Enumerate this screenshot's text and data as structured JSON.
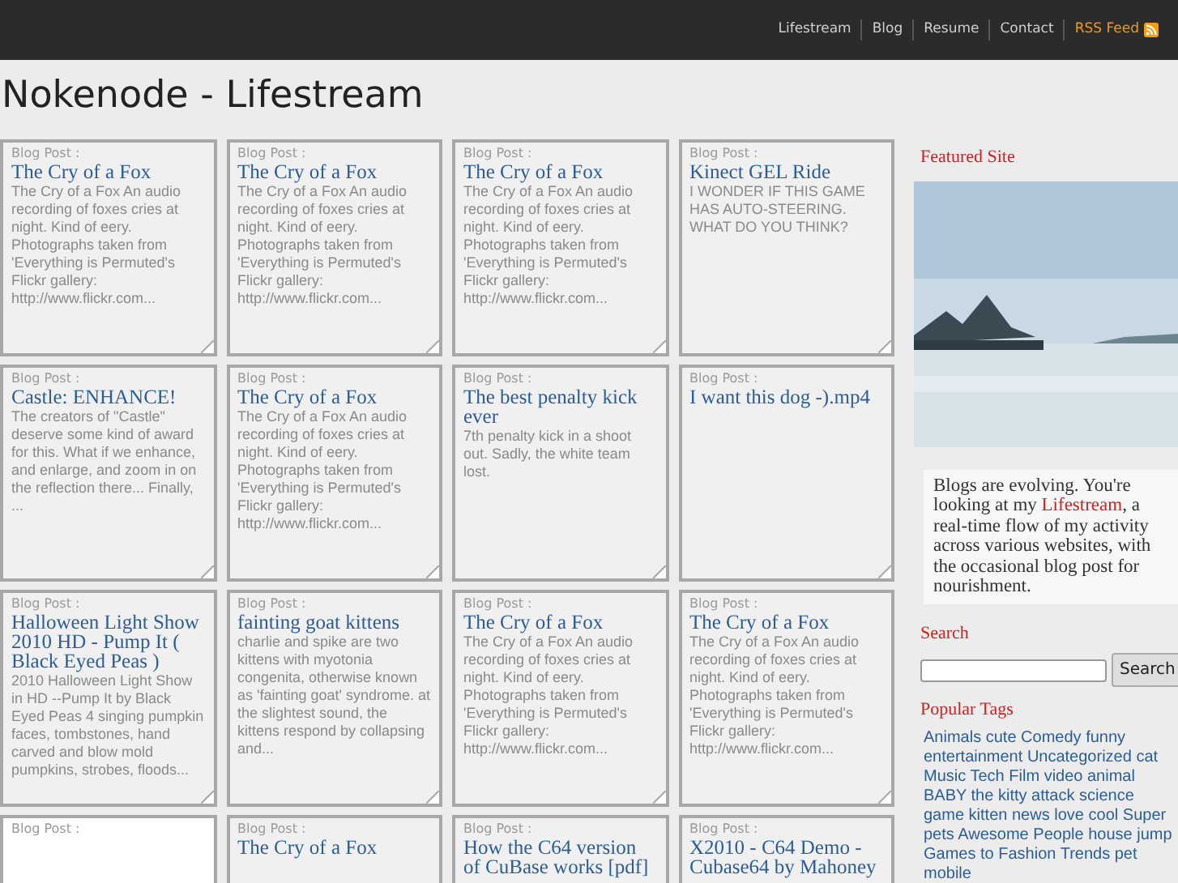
{
  "nav": [
    {
      "label": "Lifestream",
      "kind": "link"
    },
    {
      "label": "Blog",
      "kind": "link"
    },
    {
      "label": "Resume",
      "kind": "link"
    },
    {
      "label": "Contact",
      "kind": "link"
    },
    {
      "label": "RSS Feed",
      "kind": "feed"
    }
  ],
  "page_title": "Nokenode - Lifestream",
  "posts": [
    {
      "kind": "text",
      "folded": true,
      "category": "Blog Post :",
      "title": "The Cry of a Fox",
      "body": "The Cry of a Fox An audio recording of foxes cries at night. Kind of eery. Photographs taken from 'Everything is Permuted's Flickr gallery: http://www.flickr.com..."
    },
    {
      "kind": "text",
      "folded": true,
      "category": "Blog Post :",
      "title": "The Cry of a Fox",
      "body": "The Cry of a Fox An audio recording of foxes cries at night. Kind of eery. Photographs taken from 'Everything is Permuted's Flickr gallery: http://www.flickr.com..."
    },
    {
      "kind": "text",
      "folded": true,
      "category": "Blog Post :",
      "title": "The Cry of a Fox",
      "body": "The Cry of a Fox An audio recording of foxes cries at night. Kind of eery. Photographs taken from 'Everything is Permuted's Flickr gallery: http://www.flickr.com..."
    },
    {
      "kind": "text",
      "folded": true,
      "category": "Blog Post :",
      "title": "Kinect GEL Ride",
      "body": "I WONDER IF THIS GAME HAS AUTO-STEERING. WHAT DO YOU THINK?"
    },
    {
      "kind": "text",
      "folded": true,
      "category": "Blog Post :",
      "title": "Castle: ENHANCE!",
      "body": "The creators of \"Castle\" deserve some kind of award for this. What if we enhance, and enlarge, and zoom in on the reflection there... Finally, ..."
    },
    {
      "kind": "text",
      "folded": true,
      "category": "Blog Post :",
      "title": "The Cry of a Fox",
      "body": "The Cry of a Fox An audio recording of foxes cries at night. Kind of eery. Photographs taken from 'Everything is Permuted's Flickr gallery: http://www.flickr.com..."
    },
    {
      "kind": "text",
      "folded": true,
      "category": "Blog Post :",
      "title": "The best penalty kick ever",
      "body": "7th penalty kick in a shoot out. Sadly, the white team lost."
    },
    {
      "kind": "text",
      "folded": true,
      "category": "Blog Post :",
      "title": "I want this dog -).mp4"
    },
    {
      "kind": "text",
      "folded": true,
      "category": "Blog Post :",
      "title": "Halloween Light Show 2010 HD - Pump It ( Black Eyed Peas )",
      "body": "2010 Halloween Light Show in HD --Pump It by Black Eyed Peas 4 singing pumpkin faces, tombstones, hand carved and blow mold pumpkins, strobes, floods..."
    },
    {
      "kind": "text",
      "folded": true,
      "category": "Blog Post :",
      "title": "fainting goat kittens",
      "body": "charlie and spike are two kittens with myotonia congenita, otherwise known as 'fainting goat' syndrome. at the slightest sound, the kittens respond by collapsing and..."
    },
    {
      "kind": "text",
      "folded": true,
      "category": "Blog Post :",
      "title": "The Cry of a Fox",
      "body": "The Cry of a Fox An audio recording of foxes cries at night. Kind of eery. Photographs taken from 'Everything is Permuted's Flickr gallery: http://www.flickr.com..."
    },
    {
      "kind": "text",
      "folded": true,
      "category": "Blog Post :",
      "title": "The Cry of a Fox",
      "body": "The Cry of a Fox An audio recording of foxes cries at night. Kind of eery. Photographs taken from 'Everything is Permuted's Flickr gallery: http://www.flickr.com..."
    },
    {
      "kind": "picture",
      "category": "Blog Post :"
    },
    {
      "kind": "text",
      "category": "Blog Post :",
      "title": "The Cry of a Fox"
    },
    {
      "kind": "text",
      "category": "Blog Post :",
      "title": "How the C64 version of CuBase works [pdf]"
    },
    {
      "kind": "text",
      "category": "Blog Post :",
      "title": "X2010 - C64 Demo - Cubase64 by Mahoney"
    }
  ],
  "sidebar": {
    "featured_heading": "Featured Site",
    "about": "Blogs are evolving. You're looking at my ",
    "about_link": "Lifestream",
    "about_rest": ", a real-time flow of my activity across various websites, with the occasional blog post for nourishment.",
    "search_heading": "Search",
    "search_button": "Search",
    "tags_heading": "Popular Tags",
    "tags": [
      "Animals",
      "cute",
      "Comedy",
      "funny",
      "entertainment",
      "Uncategorized",
      "cat",
      "Music",
      "Tech",
      "Film",
      "video",
      "animal",
      "BABY",
      "the",
      "kitty",
      "attack",
      "science",
      "game",
      "kitten",
      "news",
      "love",
      "cool",
      "Super",
      "pets",
      "Awesome",
      "People",
      "house",
      "jump",
      "Games",
      "to",
      "Fashion",
      "Trends",
      "pet",
      "mobile"
    ]
  }
}
